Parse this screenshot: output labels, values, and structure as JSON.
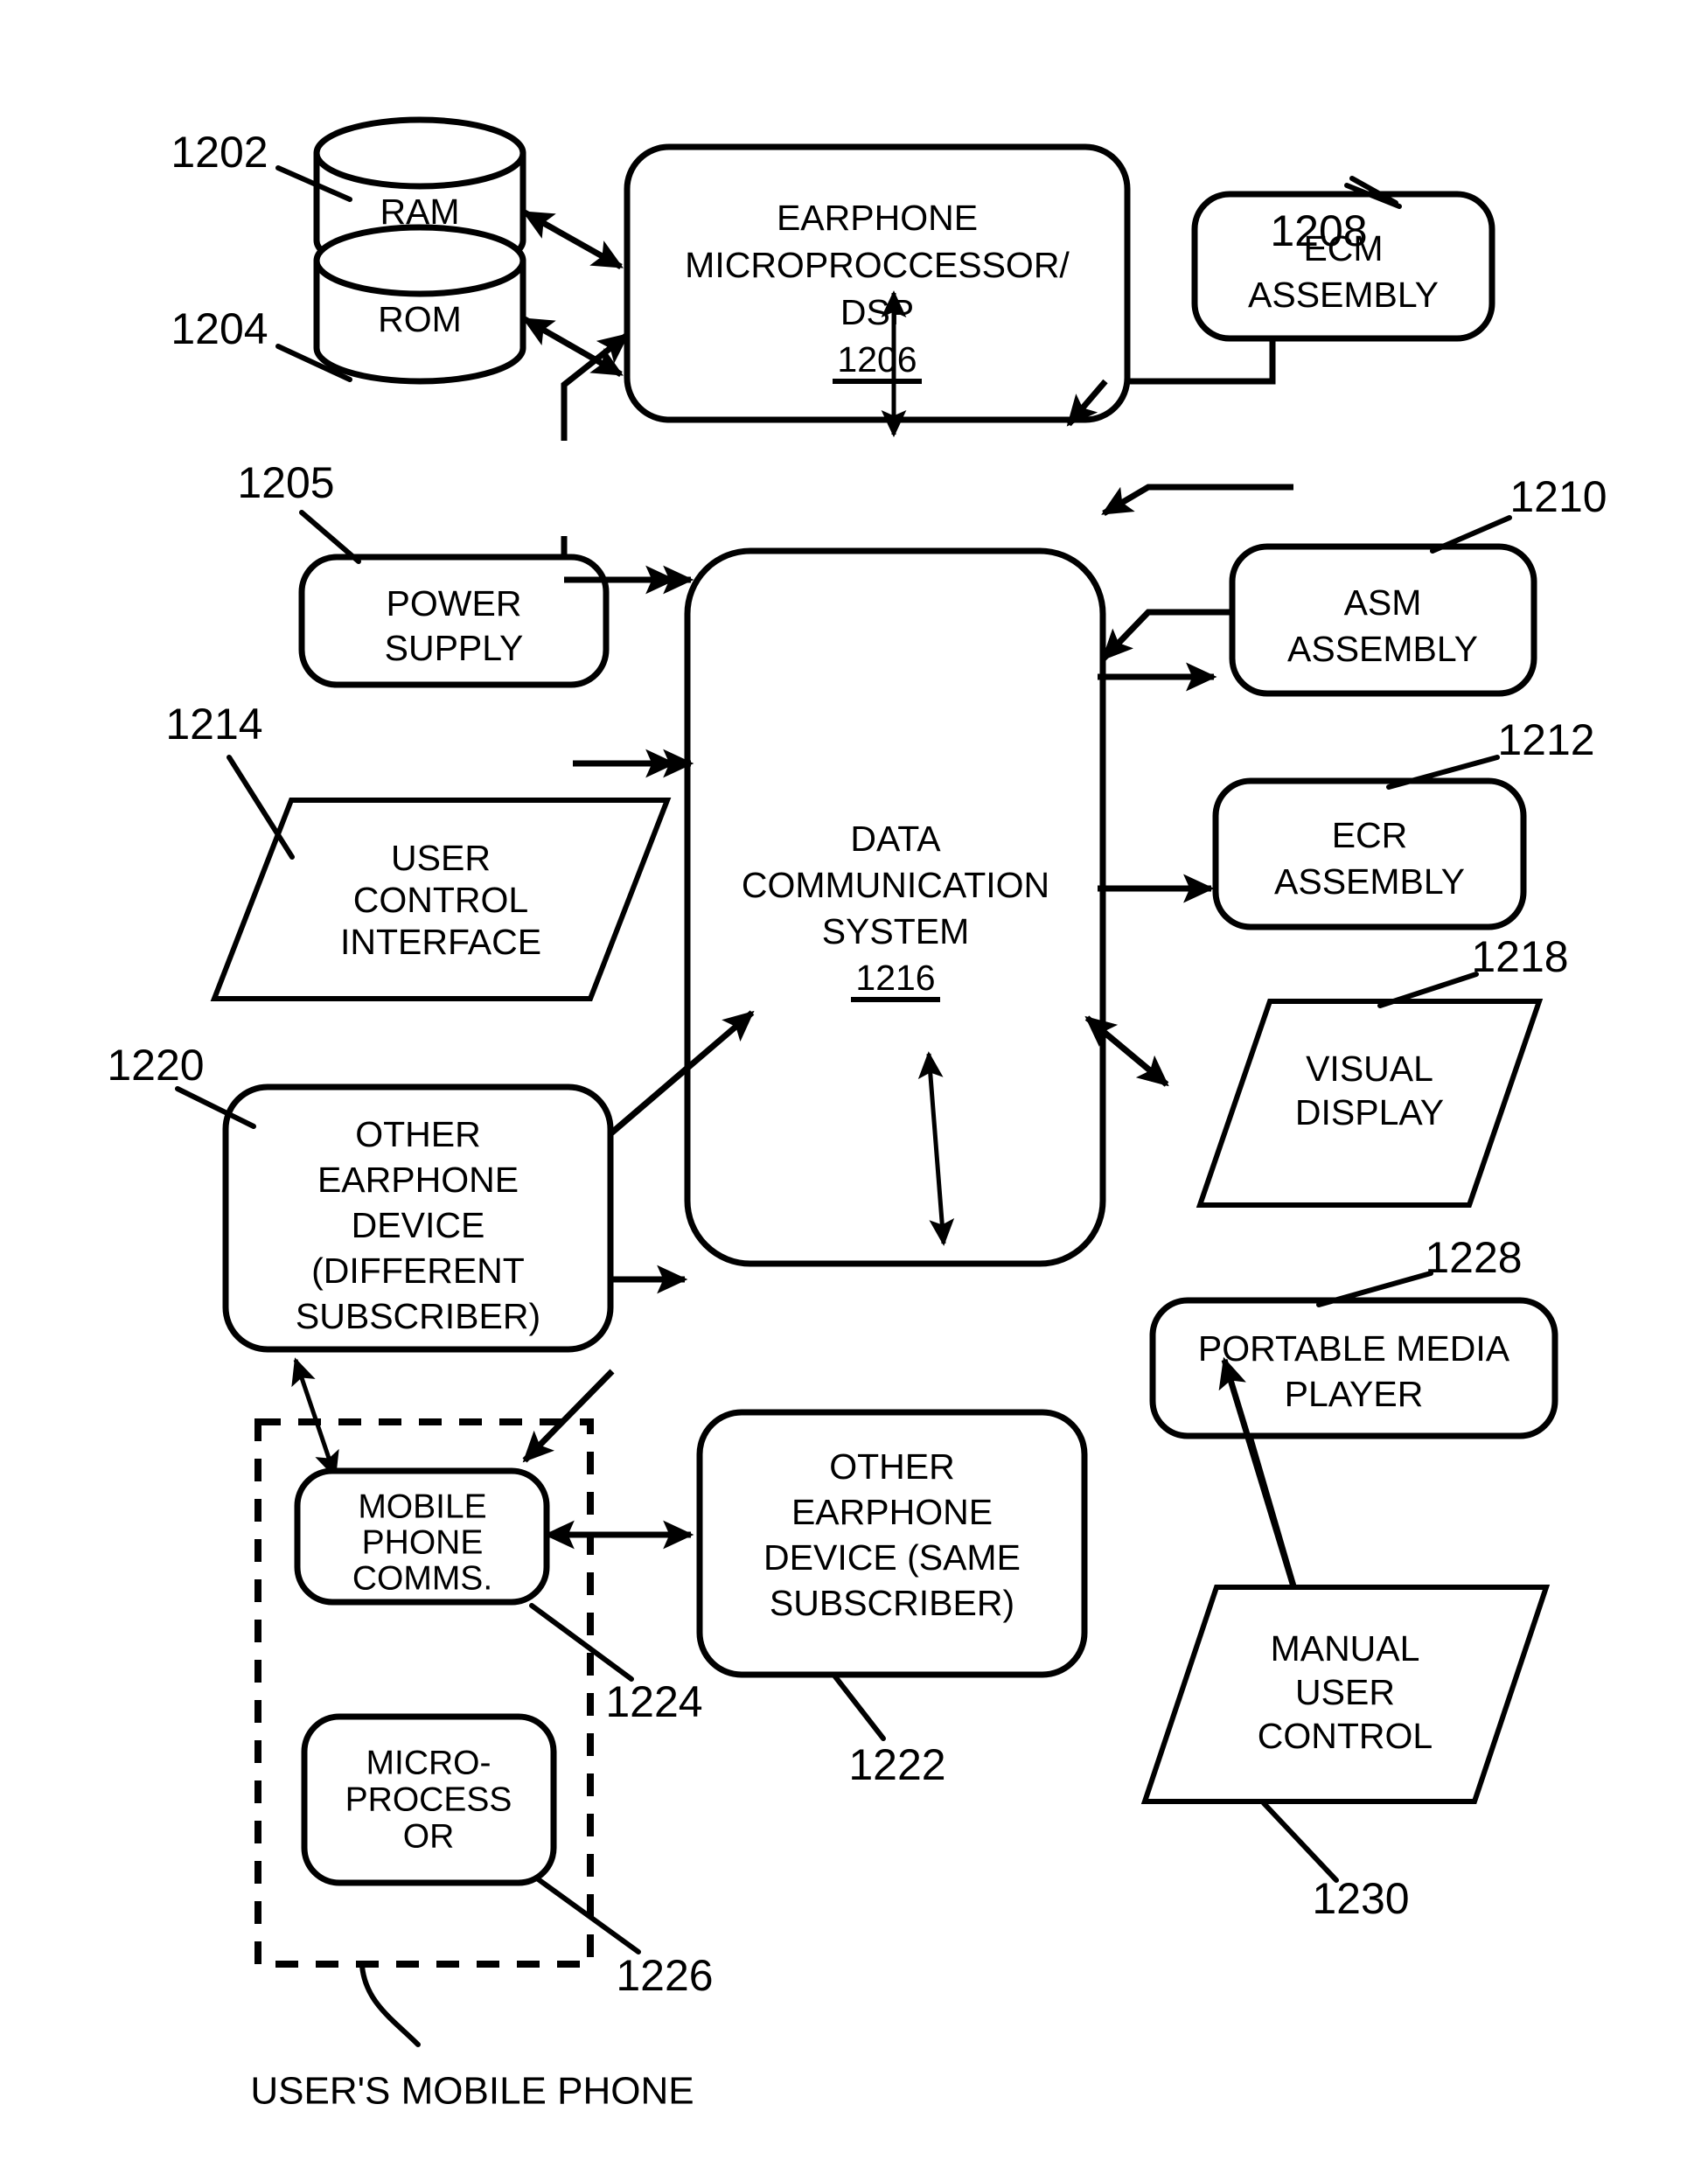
{
  "figure": {
    "type": "patent-block-diagram",
    "background_color": "#ffffff",
    "line_color": "#000000",
    "caption": "USER'S MOBILE PHONE"
  },
  "nodes": {
    "ram": {
      "label": "RAM",
      "ref": "1202",
      "shape": "cylinder"
    },
    "rom": {
      "label": "ROM",
      "ref": "1204",
      "shape": "cylinder"
    },
    "dsp": {
      "line1": "EARPHONE",
      "line2": "MICROPROCCESSOR/",
      "line3": "DSP",
      "ref": "1206",
      "ref_inside": true,
      "shape": "rounded-rect"
    },
    "ecm": {
      "line1": "ECM",
      "line2": "ASSEMBLY",
      "ref": "1208",
      "shape": "rounded-rect"
    },
    "asm": {
      "line1": "ASM",
      "line2": "ASSEMBLY",
      "ref": "1210",
      "shape": "rounded-rect"
    },
    "ecr": {
      "line1": "ECR",
      "line2": "ASSEMBLY",
      "ref": "1212",
      "shape": "rounded-rect"
    },
    "power_supply": {
      "line1": "POWER",
      "line2": "SUPPLY",
      "ref": "1205",
      "shape": "rounded-rect"
    },
    "user_control_interface": {
      "line1": "USER",
      "line2": "CONTROL",
      "line3": "INTERFACE",
      "ref": "1214",
      "shape": "parallelogram"
    },
    "data_comm_system": {
      "line1": "DATA",
      "line2": "COMMUNICATION",
      "line3": "SYSTEM",
      "ref": "1216",
      "ref_inside": true,
      "shape": "rounded-rect"
    },
    "visual_display": {
      "line1": "VISUAL",
      "line2": "DISPLAY",
      "ref": "1218",
      "shape": "parallelogram"
    },
    "other_earphone_different": {
      "line1": "OTHER",
      "line2": "EARPHONE",
      "line3": "DEVICE",
      "line4": "(DIFFERENT",
      "line5": "SUBSCRIBER)",
      "ref": "1220",
      "shape": "rounded-rect"
    },
    "other_earphone_same": {
      "line1": "OTHER",
      "line2": "EARPHONE",
      "line3": "DEVICE (SAME",
      "line4": "SUBSCRIBER)",
      "ref": "1222",
      "shape": "rounded-rect"
    },
    "mobile_phone_comms": {
      "line1": "MOBILE",
      "line2": "PHONE",
      "line3": "COMMS.",
      "ref": "1224",
      "shape": "rounded-rect"
    },
    "mobile_microprocessor": {
      "line1": "MICRO-",
      "line2": "PROCESS",
      "line3": "OR",
      "ref": "1226",
      "shape": "rounded-rect"
    },
    "portable_media_player": {
      "line1": "PORTABLE MEDIA",
      "line2": "PLAYER",
      "ref": "1228",
      "shape": "rounded-rect"
    },
    "manual_user_control": {
      "line1": "MANUAL",
      "line2": "USER",
      "line3": "CONTROL",
      "ref": "1230",
      "shape": "parallelogram"
    }
  },
  "connections": [
    {
      "from": "dsp",
      "to": "ram",
      "style": "double-arrow"
    },
    {
      "from": "dsp",
      "to": "rom",
      "style": "double-arrow"
    },
    {
      "from": "dsp",
      "to": "data_comm_system",
      "style": "double-arrow-vertical"
    },
    {
      "from": "power_supply",
      "to": "dsp",
      "style": "arrow"
    },
    {
      "from": "power_supply",
      "to": "data_comm_system",
      "style": "arrow"
    },
    {
      "from": "ecm",
      "to": "data_comm_system",
      "style": "arrow"
    },
    {
      "from": "asm",
      "to": "data_comm_system",
      "style": "arrow"
    },
    {
      "from": "user_control_interface",
      "to": "data_comm_system",
      "style": "arrow"
    },
    {
      "from": "data_comm_system",
      "to": "ecr",
      "style": "arrow"
    },
    {
      "from": "data_comm_system",
      "to": "visual_display",
      "style": "arrow"
    },
    {
      "from": "other_earphone_different",
      "to": "mobile_phone_comms",
      "style": "double-arrow-dotted"
    },
    {
      "from": "mobile_phone_comms",
      "to": "data_comm_system",
      "style": "double-arrow"
    },
    {
      "from": "mobile_phone_comms",
      "to": "other_earphone_same",
      "style": "double-arrow"
    },
    {
      "from": "other_earphone_same",
      "to": "data_comm_system",
      "style": "double-arrow"
    },
    {
      "from": "portable_media_player",
      "to": "data_comm_system",
      "style": "double-arrow"
    },
    {
      "from": "manual_user_control",
      "to": "portable_media_player",
      "style": "arrow"
    }
  ]
}
